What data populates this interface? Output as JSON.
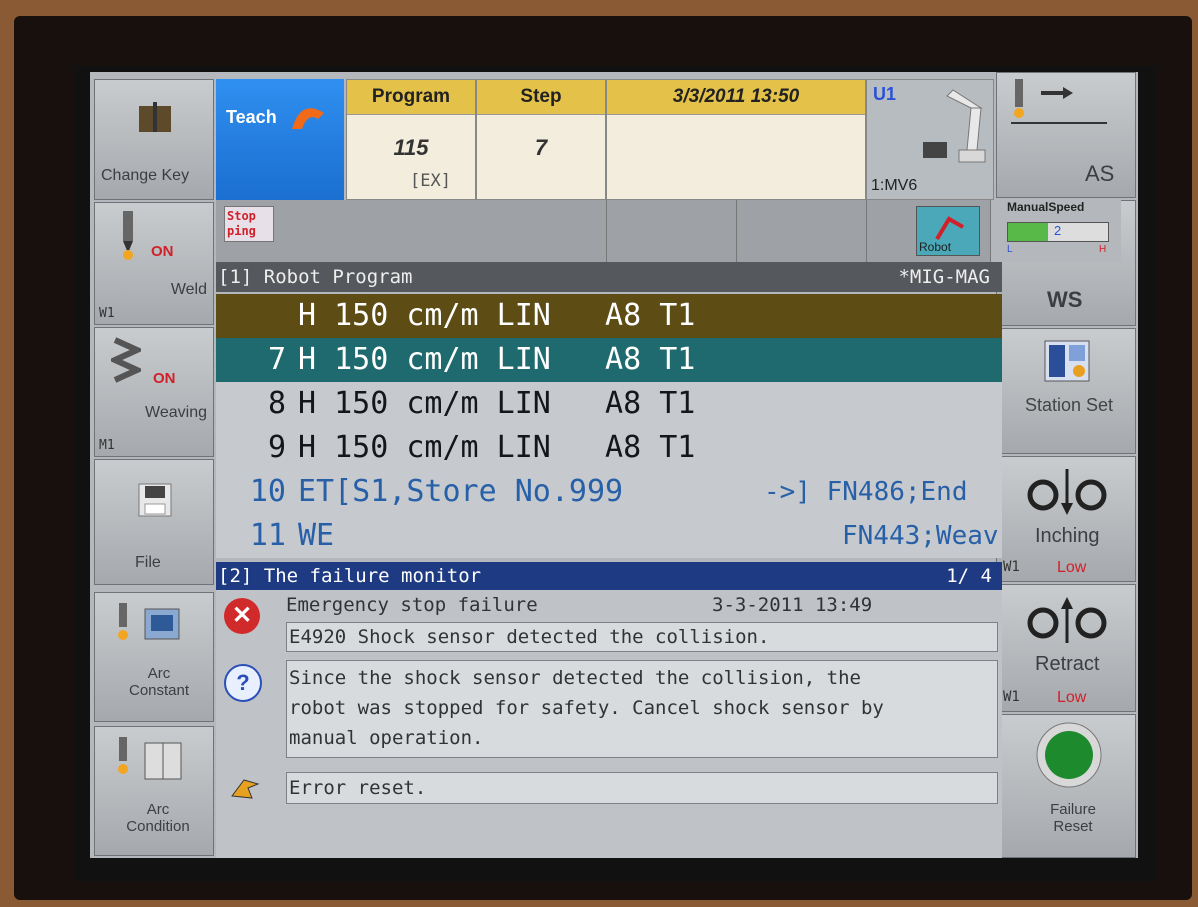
{
  "left_buttons": [
    {
      "label": "Change Key",
      "icon": "book-icon"
    },
    {
      "label": "Weld",
      "status": "ON",
      "sub": "W1",
      "icon": "torch-icon"
    },
    {
      "label": "Weaving",
      "status": "ON",
      "sub": "M1",
      "icon": "weaving-icon"
    },
    {
      "label": "File",
      "icon": "floppy-icon"
    },
    {
      "label": "Arc Constant",
      "icon": "arc-constant-icon"
    },
    {
      "label": "Arc Condition",
      "icon": "arc-condition-icon"
    }
  ],
  "right_buttons": [
    {
      "label": "AS",
      "icon": "torch-arrow-icon"
    },
    {
      "label": "WS",
      "icon": "torch-weave-icon"
    },
    {
      "label": "Station Set",
      "icon": "station-icon"
    },
    {
      "label": "Inching",
      "sub": "W1",
      "level": "Low",
      "icon": "inching-icon"
    },
    {
      "label": "Retract",
      "sub": "W1",
      "level": "Low",
      "icon": "retract-icon"
    },
    {
      "label": "Failure Reset",
      "icon": "green-reset-icon"
    }
  ],
  "header": {
    "mode": "Teach",
    "program_label": "Program",
    "program_value": "115",
    "program_sub": "[EX]",
    "step_label": "Step",
    "step_value": "7",
    "datetime": "3/3/2011 13:50",
    "robot_unit": "U1",
    "robot_model": "1:MV6"
  },
  "status": {
    "stopping": "Stop ping",
    "robot_button": "Robot",
    "manual_speed_label": "ManualSpeed",
    "manual_speed_value": "2",
    "speed_L": "L",
    "speed_H": "H"
  },
  "program": {
    "title": "[1] Robot Program",
    "mode": "*MIG-MAG",
    "lines": [
      {
        "num": "",
        "text": "H 150 cm/m LIN   A8 T1",
        "right": ""
      },
      {
        "num": "7",
        "text": "H 150 cm/m LIN   A8 T1",
        "right": ""
      },
      {
        "num": "8",
        "text": "H 150 cm/m LIN   A8 T1",
        "right": ""
      },
      {
        "num": "9",
        "text": "H 150 cm/m LIN   A8 T1",
        "right": ""
      },
      {
        "num": "10",
        "text": "ET[S1,Store No.999",
        "right": "->] FN486;End"
      },
      {
        "num": "11",
        "text": "WE",
        "right": "FN443;Weav"
      }
    ]
  },
  "failure": {
    "title": "[2] The failure monitor",
    "page": "1/ 4",
    "type": "Emergency stop failure",
    "timestamp": "3-3-2011 13:49",
    "code_message": "E4920  Shock sensor detected the collision.",
    "help_line1": "Since the shock sensor detected the collision, the",
    "help_line2": "robot was stopped for safety. Cancel shock sensor by",
    "help_line3": "manual operation.",
    "action": "Error reset."
  }
}
